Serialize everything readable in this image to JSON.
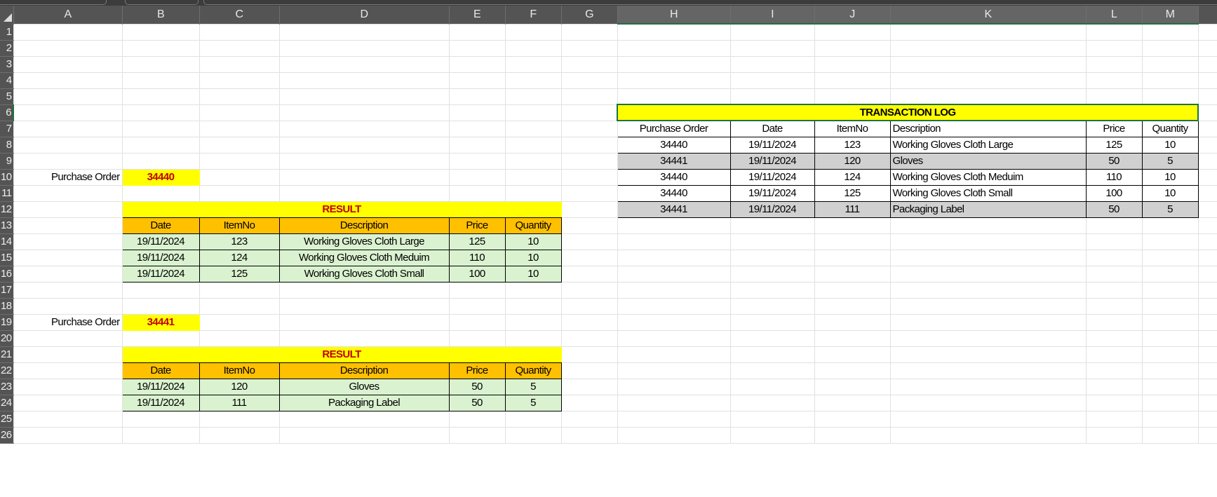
{
  "sheet": {
    "columns": [
      "A",
      "B",
      "C",
      "D",
      "E",
      "F",
      "G",
      "H",
      "I",
      "J",
      "K",
      "L",
      "M"
    ],
    "row_count": 26,
    "selected_row": 6,
    "selected_columns": [
      "H",
      "I",
      "J",
      "K",
      "L",
      "M"
    ]
  },
  "lookups": [
    {
      "label": "Purchase Order",
      "value": "34440",
      "result": {
        "title": "RESULT",
        "headers": [
          "Date",
          "ItemNo",
          "Description",
          "Price",
          "Quantity"
        ],
        "rows": [
          [
            "19/11/2024",
            "123",
            "Working Gloves Cloth Large",
            "125",
            "10"
          ],
          [
            "19/11/2024",
            "124",
            "Working Gloves Cloth Meduim",
            "110",
            "10"
          ],
          [
            "19/11/2024",
            "125",
            "Working Gloves Cloth Small",
            "100",
            "10"
          ]
        ]
      }
    },
    {
      "label": "Purchase Order",
      "value": "34441",
      "result": {
        "title": "RESULT",
        "headers": [
          "Date",
          "ItemNo",
          "Description",
          "Price",
          "Quantity"
        ],
        "rows": [
          [
            "19/11/2024",
            "120",
            "Gloves",
            "50",
            "5"
          ],
          [
            "19/11/2024",
            "111",
            "Packaging Label",
            "50",
            "5"
          ]
        ]
      }
    }
  ],
  "transaction_log": {
    "title": "TRANSACTION LOG",
    "headers": [
      "Purchase Order",
      "Date",
      "ItemNo",
      "Description",
      "Price",
      "Quantity"
    ],
    "rows": [
      [
        "34440",
        "19/11/2024",
        "123",
        "Working Gloves Cloth Large",
        "125",
        "10"
      ],
      [
        "34441",
        "19/11/2024",
        "120",
        "Gloves",
        "50",
        "5"
      ],
      [
        "34440",
        "19/11/2024",
        "124",
        "Working Gloves Cloth Meduim",
        "110",
        "10"
      ],
      [
        "34440",
        "19/11/2024",
        "125",
        "Working Gloves Cloth Small",
        "100",
        "10"
      ],
      [
        "34441",
        "19/11/2024",
        "111",
        "Packaging Label",
        "50",
        "5"
      ]
    ]
  },
  "colors": {
    "yellow": "#FFFF00",
    "orange": "#FFC000",
    "green_fill": "#DAF2D0",
    "gray_fill": "#D0D0D0",
    "red_text": "#C00000",
    "selection": "#1E7145"
  }
}
